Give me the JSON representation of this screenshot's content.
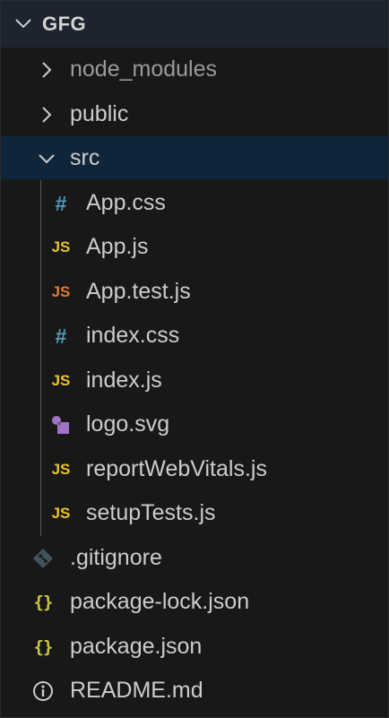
{
  "explorer": {
    "root": {
      "label": "GFG",
      "expanded": true,
      "icon": "chevron-down-icon"
    },
    "items": [
      {
        "label": "node_modules",
        "type": "folder",
        "expanded": false,
        "icon": "chevron-right-icon"
      },
      {
        "label": "public",
        "type": "folder",
        "expanded": false,
        "icon": "chevron-right-icon"
      },
      {
        "label": "src",
        "type": "folder",
        "expanded": true,
        "selected": true,
        "icon": "chevron-down-icon"
      },
      {
        "label": "App.css",
        "type": "file",
        "icon": "css-file-icon",
        "glyph": "#"
      },
      {
        "label": "App.js",
        "type": "file",
        "icon": "js-file-icon",
        "glyph": "JS"
      },
      {
        "label": "App.test.js",
        "type": "file",
        "icon": "js-test-file-icon",
        "glyph": "JS"
      },
      {
        "label": "index.css",
        "type": "file",
        "icon": "css-file-icon",
        "glyph": "#"
      },
      {
        "label": "index.js",
        "type": "file",
        "icon": "js-file-icon",
        "glyph": "JS"
      },
      {
        "label": "logo.svg",
        "type": "file",
        "icon": "svg-file-icon"
      },
      {
        "label": "reportWebVitals.js",
        "type": "file",
        "icon": "js-file-icon",
        "glyph": "JS"
      },
      {
        "label": "setupTests.js",
        "type": "file",
        "icon": "js-file-icon",
        "glyph": "JS"
      },
      {
        "label": ".gitignore",
        "type": "file",
        "icon": "git-file-icon"
      },
      {
        "label": "package-lock.json",
        "type": "file",
        "icon": "json-file-icon",
        "glyph": "{}"
      },
      {
        "label": "package.json",
        "type": "file",
        "icon": "json-file-icon",
        "glyph": "{}"
      },
      {
        "label": "README.md",
        "type": "file",
        "icon": "info-file-icon"
      }
    ]
  },
  "colors": {
    "background": "#181818",
    "root_header_bg": "#1d2430",
    "selected_bg": "#0f2539",
    "js": "#e8c22c",
    "js_test": "#e37933",
    "css": "#519aba",
    "json": "#cbcb41",
    "svg": "#a074c4",
    "git": "#41535b",
    "info": "#cccccc"
  }
}
